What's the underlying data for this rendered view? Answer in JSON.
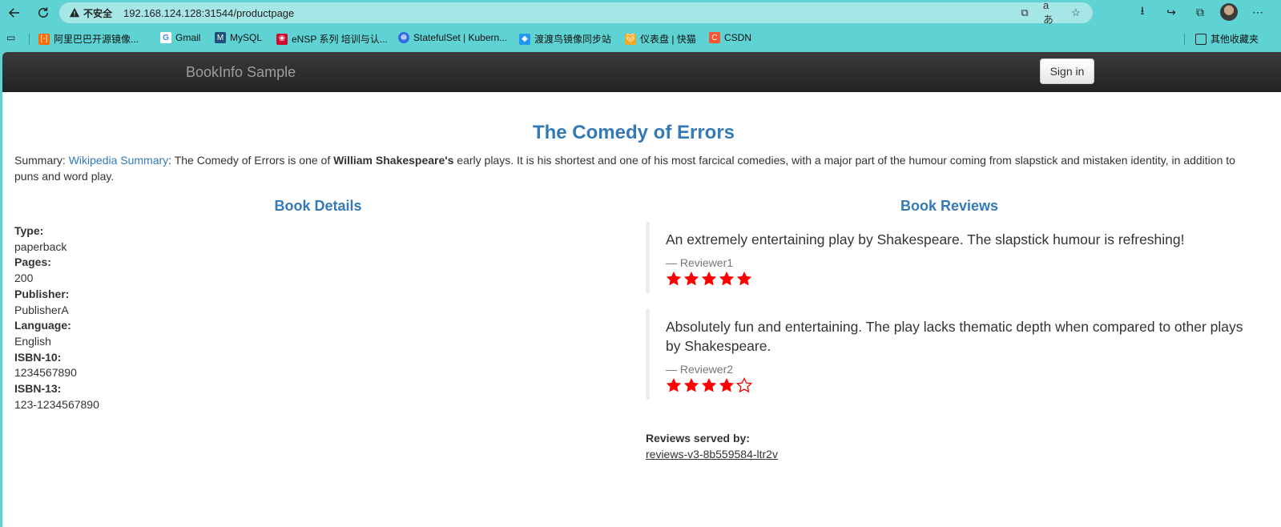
{
  "browser": {
    "security_label": "不安全",
    "url": "192.168.124.128:31544/productpage",
    "bookmarks": [
      {
        "label": "阿里巴巴开源镜像...",
        "icon": "aliyun-icon",
        "color": "#ff6a00"
      },
      {
        "label": "Gmail",
        "icon": "google-icon",
        "color": "#4285f4"
      },
      {
        "label": "MySQL",
        "icon": "mysql-icon",
        "color": "#1f4e79"
      },
      {
        "label": "eNSP 系列 培训与认...",
        "icon": "huawei-icon",
        "color": "#cf0a2c"
      },
      {
        "label": "StatefulSet | Kubern...",
        "icon": "kubernetes-icon",
        "color": "#326ce5"
      },
      {
        "label": "渡渡鸟镜像同步站",
        "icon": "docker-icon",
        "color": "#2496ed"
      },
      {
        "label": "仪表盘 | 快猫",
        "icon": "cat-icon",
        "color": "#f5a623"
      },
      {
        "label": "CSDN",
        "icon": "csdn-icon",
        "color": "#fc5531"
      }
    ],
    "other_bookmarks": "其他收藏夹"
  },
  "navbar": {
    "brand": "BookInfo Sample",
    "signin_label": "Sign in"
  },
  "book": {
    "title": "The Comedy of Errors",
    "summary_prefix": "Summary: ",
    "summary_link": "Wikipedia Summary",
    "summary_text_1": ": The Comedy of Errors is one of ",
    "summary_author": "William Shakespeare's",
    "summary_text_2": " early plays. It is his shortest and one of his most farcical comedies, with a major part of the humour coming from slapstick and mistaken identity, in addition to puns and word play."
  },
  "details": {
    "heading": "Book Details",
    "fields": [
      {
        "label": "Type:",
        "value": "paperback"
      },
      {
        "label": "Pages:",
        "value": "200"
      },
      {
        "label": "Publisher:",
        "value": "PublisherA"
      },
      {
        "label": "Language:",
        "value": "English"
      },
      {
        "label": "ISBN-10:",
        "value": "1234567890"
      },
      {
        "label": "ISBN-13:",
        "value": "123-1234567890"
      }
    ]
  },
  "reviews": {
    "heading": "Book Reviews",
    "star_color": "#ff0000",
    "items": [
      {
        "text": "An extremely entertaining play by Shakespeare. The slapstick humour is refreshing!",
        "author": "— Reviewer1",
        "rating": 5,
        "max": 5
      },
      {
        "text": "Absolutely fun and entertaining. The play lacks thematic depth when compared to other plays by Shakespeare.",
        "author": "— Reviewer2",
        "rating": 4,
        "max": 5
      }
    ],
    "served_by_label": "Reviews served by:",
    "served_by_value": "reviews-v3-8b559584-ltr2v"
  }
}
